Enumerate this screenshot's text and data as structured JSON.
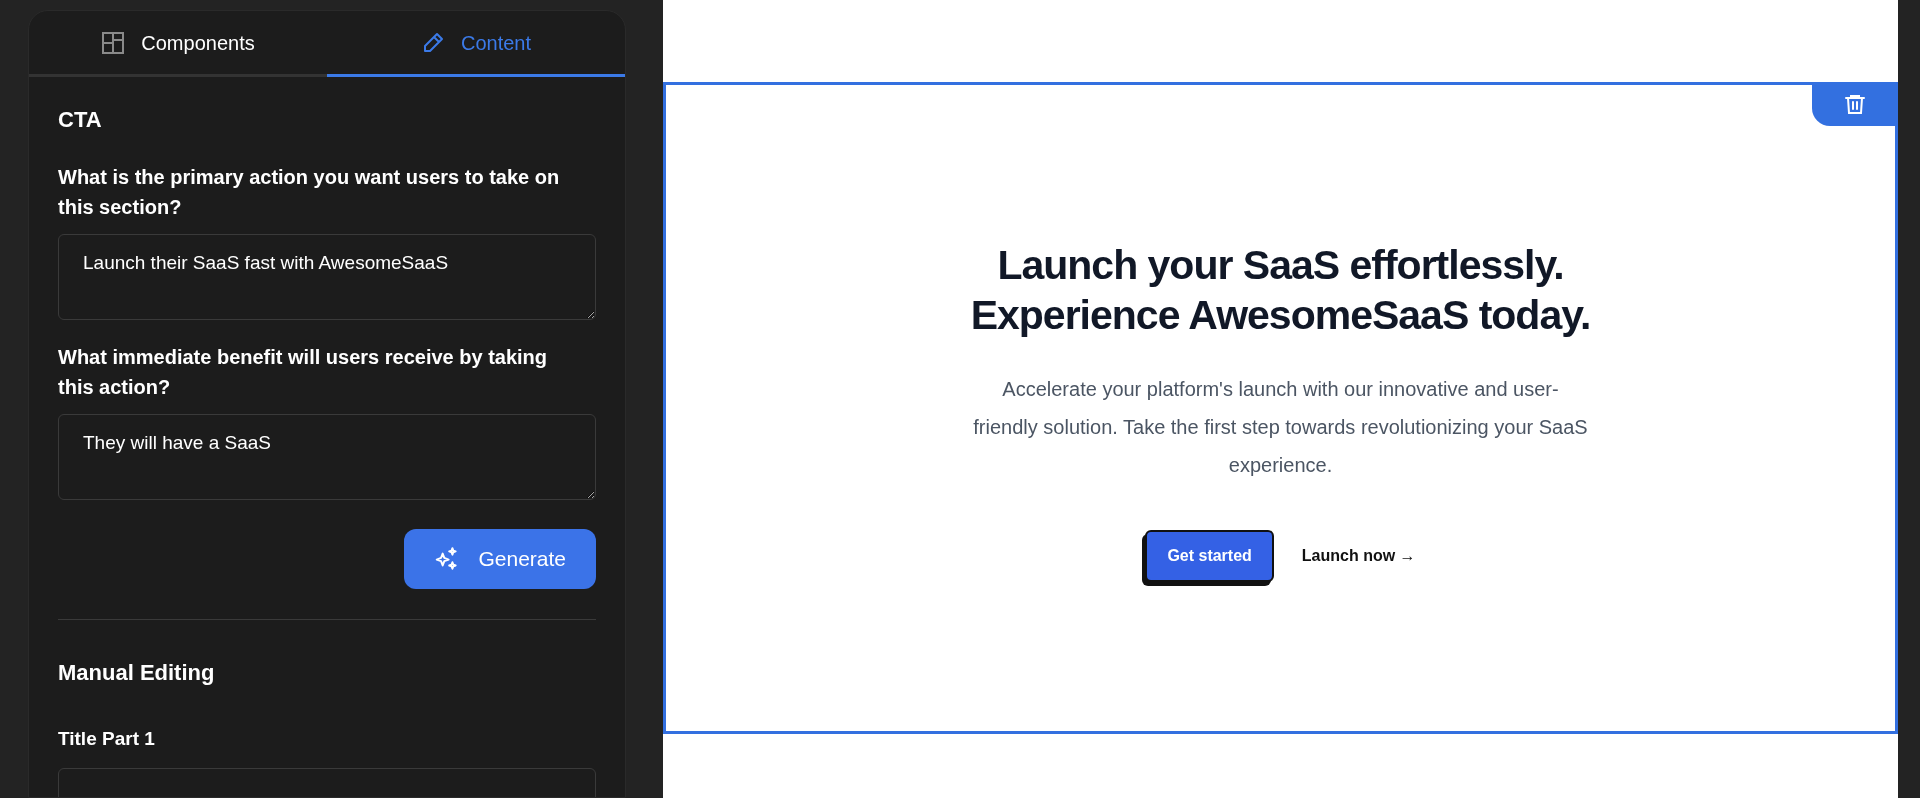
{
  "tabs": [
    {
      "label": "Components",
      "selected": false
    },
    {
      "label": "Content",
      "selected": true
    }
  ],
  "editor": {
    "section_title": "CTA",
    "questions": [
      {
        "label": "What is the primary action you want users to take on this section?",
        "value": "Launch their SaaS fast with AwesomeSaaS"
      },
      {
        "label": "What immediate benefit will users receive by taking this action?",
        "value": "They will have a SaaS"
      }
    ],
    "generate_button": "Generate",
    "manual_title": "Manual Editing",
    "fields": [
      {
        "label": "Title Part 1"
      }
    ]
  },
  "preview": {
    "selected": true,
    "headline": [
      "Launch your SaaS effortlessly.",
      "Experience AwesomeSaaS today."
    ],
    "description": "Accelerate your platform's launch with our innovative and user-friendly solution. Take the first step towards revolutionizing your SaaS experience.",
    "primary_button": "Get started",
    "secondary_link": "Launch now →"
  }
}
